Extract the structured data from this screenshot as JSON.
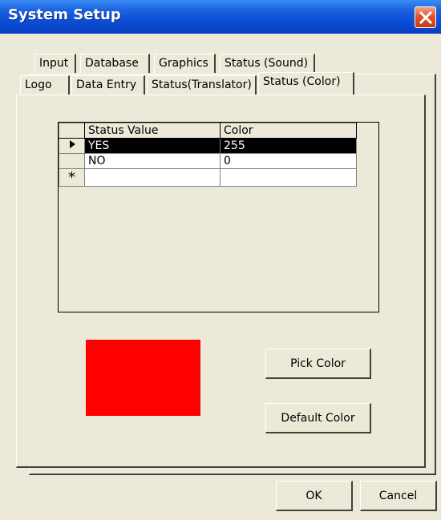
{
  "window": {
    "title": "System Setup"
  },
  "tabs_row1": [
    "Input",
    "Database",
    "Graphics",
    "Status (Sound)"
  ],
  "tabs_row2": [
    "Logo",
    "Data Entry",
    "Status(Translator)",
    "Status (Color)"
  ],
  "active_tab": "Status (Color)",
  "grid": {
    "columns": [
      "Status Value",
      "Color"
    ],
    "rows": [
      {
        "status": "YES",
        "color": "255",
        "selected": true
      },
      {
        "status": "NO",
        "color": "0",
        "selected": false
      }
    ],
    "new_row_marker": "*"
  },
  "preview_color": "#ff0000",
  "buttons": {
    "pick_color": "Pick Color",
    "default_color": "Default Color",
    "ok": "OK",
    "cancel": "Cancel"
  }
}
